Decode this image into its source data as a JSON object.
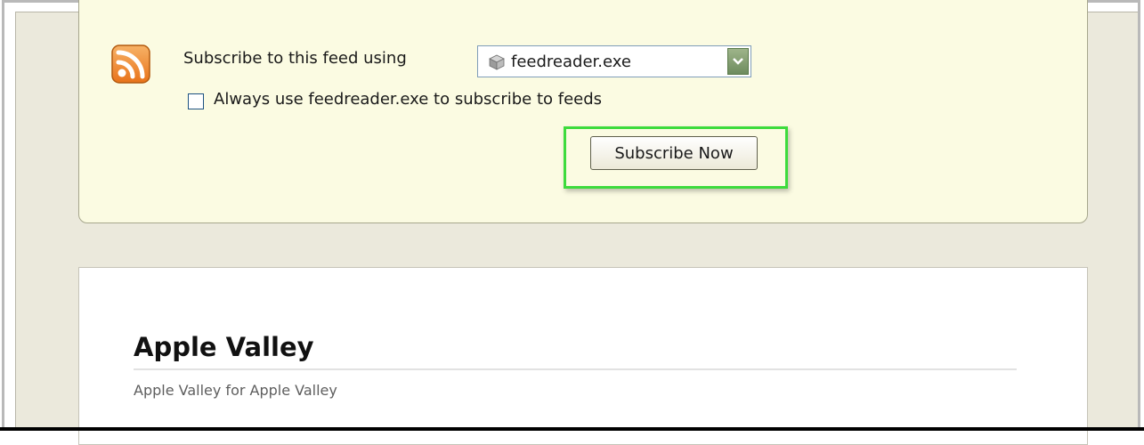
{
  "subscribe_panel": {
    "label": "Subscribe to this feed using",
    "reader_select": {
      "value": "feedreader.exe"
    },
    "always_use": {
      "label": "Always use feedreader.exe to subscribe to feeds",
      "checked": false
    },
    "subscribe_button": "Subscribe Now"
  },
  "feed": {
    "title": "Apple Valley",
    "subtitle": "Apple Valley for Apple Valley"
  },
  "colors": {
    "panel_bg": "#fbfbe2",
    "page_bg": "#ebe9dc",
    "highlight": "#3ddb3d",
    "rss_orange": "#f08a24"
  }
}
